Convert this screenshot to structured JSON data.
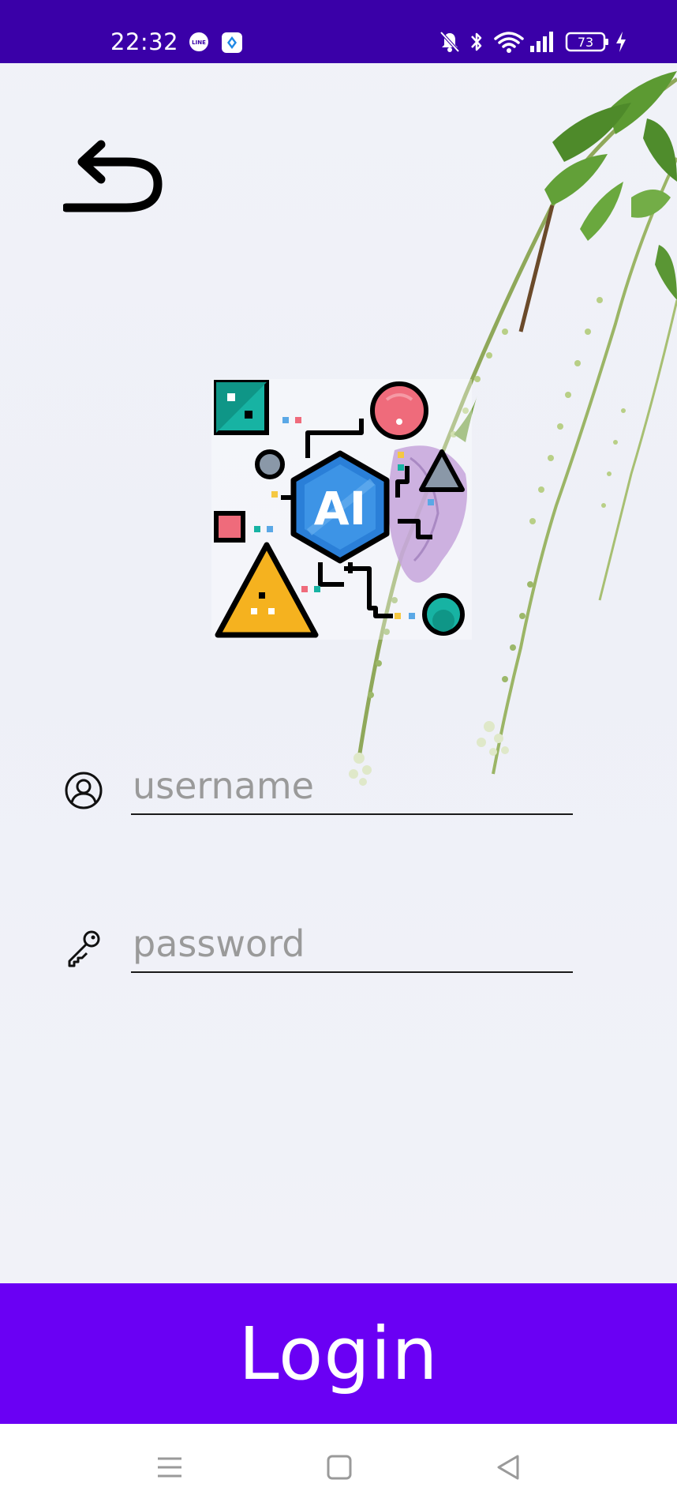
{
  "status_bar": {
    "time": "22:32",
    "line_icon": "line-app-icon",
    "app_icon": "app-notification-icon",
    "icons": [
      "mute-bell-icon",
      "bluetooth-icon",
      "wifi-icon",
      "signal-icon",
      "battery-icon",
      "charging-icon"
    ],
    "battery_level": "73",
    "background_color": "#3a00a8"
  },
  "header": {
    "back_icon": "back-arrow-icon"
  },
  "logo": {
    "icon": "ai-logo-icon",
    "text": "AI"
  },
  "form": {
    "username": {
      "icon": "user-circle-icon",
      "placeholder": "username",
      "value": ""
    },
    "password": {
      "icon": "key-icon",
      "placeholder": "password",
      "value": ""
    }
  },
  "login_button": {
    "label": "Login",
    "color": "#6a00f4"
  },
  "nav_bar": {
    "items": [
      "menu-icon",
      "home-icon",
      "back-triangle-icon"
    ]
  }
}
